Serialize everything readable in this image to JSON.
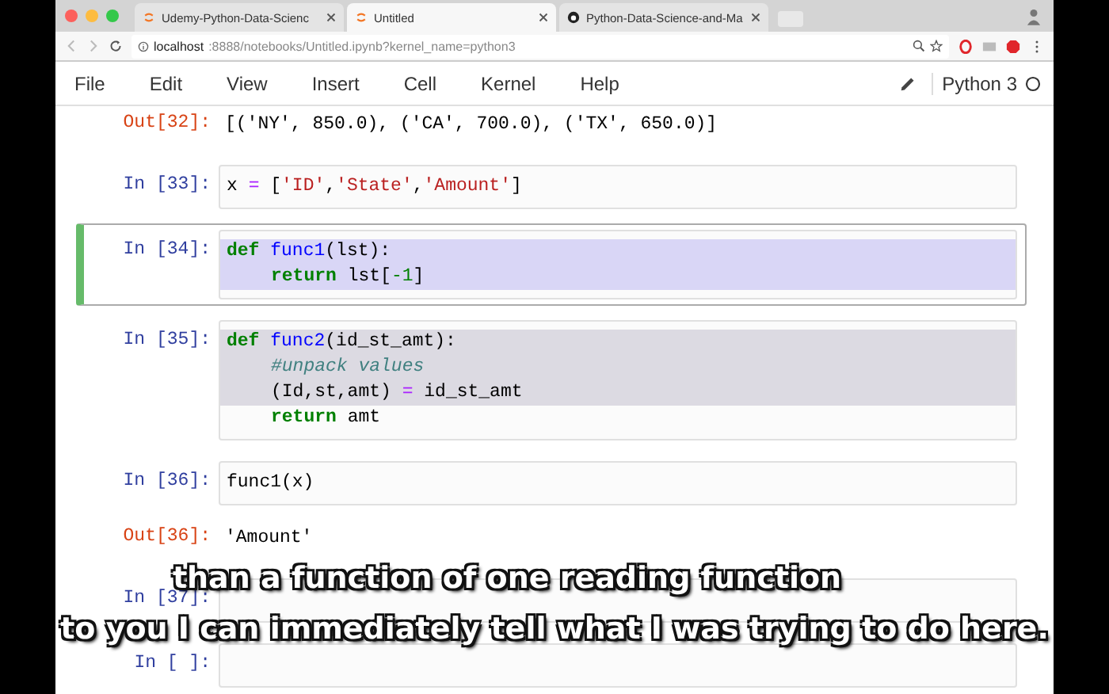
{
  "browser": {
    "tabs": [
      {
        "title": "Udemy-Python-Data-Scienc",
        "kind": "notebook",
        "selected": false
      },
      {
        "title": "Untitled",
        "kind": "notebook",
        "selected": true
      },
      {
        "title": "Python-Data-Science-and-Ma",
        "kind": "repository",
        "selected": false
      }
    ],
    "address": {
      "host": "localhost",
      "path": ":8888/notebooks/Untitled.ipynb?kernel_name=python3"
    }
  },
  "menu": {
    "items": [
      "File",
      "Edit",
      "View",
      "Insert",
      "Cell",
      "Kernel",
      "Help"
    ],
    "kernel": "Python 3"
  },
  "cells": [
    {
      "kind": "output",
      "prompt": "Out[32]:",
      "lines": [
        {
          "tokens": [
            {
              "kind": "plain",
              "t": "[('NY', 850.0), ('CA', 700.0), ('TX', 650.0)]"
            }
          ]
        }
      ]
    },
    {
      "kind": "input",
      "prompt": "In [33]:",
      "selected": false,
      "lines": [
        {
          "indented": false,
          "highlighted": false,
          "tokens": [
            {
              "kind": "plain",
              "t": "x "
            },
            {
              "kind": "op",
              "t": "="
            },
            {
              "kind": "plain",
              "t": " ["
            },
            {
              "kind": "str",
              "t": "'ID'"
            },
            {
              "kind": "plain",
              "t": ","
            },
            {
              "kind": "str",
              "t": "'State'"
            },
            {
              "kind": "plain",
              "t": ","
            },
            {
              "kind": "str",
              "t": "'Amount'"
            },
            {
              "kind": "plain",
              "t": "]"
            }
          ]
        }
      ]
    },
    {
      "kind": "input",
      "prompt": "In [34]:",
      "selected": true,
      "lines": [
        {
          "indented": false,
          "highlighted": true,
          "tokens": [
            {
              "kind": "kw",
              "t": "def"
            },
            {
              "kind": "name",
              "t": " func1"
            },
            {
              "kind": "plain",
              "t": "(lst):"
            }
          ]
        },
        {
          "indented": true,
          "highlighted": true,
          "tokens": [
            {
              "kind": "kw",
              "t": "return"
            },
            {
              "kind": "plain",
              "t": " lst["
            },
            {
              "kind": "num",
              "t": "-1"
            },
            {
              "kind": "plain",
              "t": "]"
            }
          ]
        }
      ]
    },
    {
      "kind": "input",
      "prompt": "In [35]:",
      "selected": false,
      "lines": [
        {
          "indented": false,
          "highlighted": true,
          "tokens": [
            {
              "kind": "kw",
              "t": "def"
            },
            {
              "kind": "name",
              "t": " func2"
            },
            {
              "kind": "plain",
              "t": "(id_st_amt):"
            }
          ]
        },
        {
          "indented": true,
          "highlighted": true,
          "tokens": [
            {
              "kind": "com",
              "t": "#unpack values"
            }
          ]
        },
        {
          "indented": true,
          "highlighted": true,
          "tokens": [
            {
              "kind": "plain",
              "t": "(Id,st,amt) "
            },
            {
              "kind": "op",
              "t": "="
            },
            {
              "kind": "plain",
              "t": " id_st_amt"
            }
          ]
        },
        {
          "indented": true,
          "highlighted": false,
          "tokens": [
            {
              "kind": "kw",
              "t": "return"
            },
            {
              "kind": "plain",
              "t": " amt"
            }
          ]
        }
      ]
    },
    {
      "kind": "input",
      "prompt": "In [36]:",
      "selected": false,
      "lines": [
        {
          "indented": false,
          "highlighted": false,
          "tokens": [
            {
              "kind": "plain",
              "t": "func1(x)"
            }
          ]
        }
      ]
    },
    {
      "kind": "output",
      "prompt": "Out[36]:",
      "lines": [
        {
          "tokens": [
            {
              "kind": "plain",
              "t": "'Amount'"
            }
          ]
        }
      ]
    },
    {
      "kind": "input",
      "prompt": "In [37]:",
      "selected": false
    },
    {
      "kind": "input",
      "prompt": "In [ ]:",
      "selected": false
    }
  ],
  "subtitles": [
    "than a function of one reading function",
    "to you I can immediately tell what I was trying to do here."
  ]
}
